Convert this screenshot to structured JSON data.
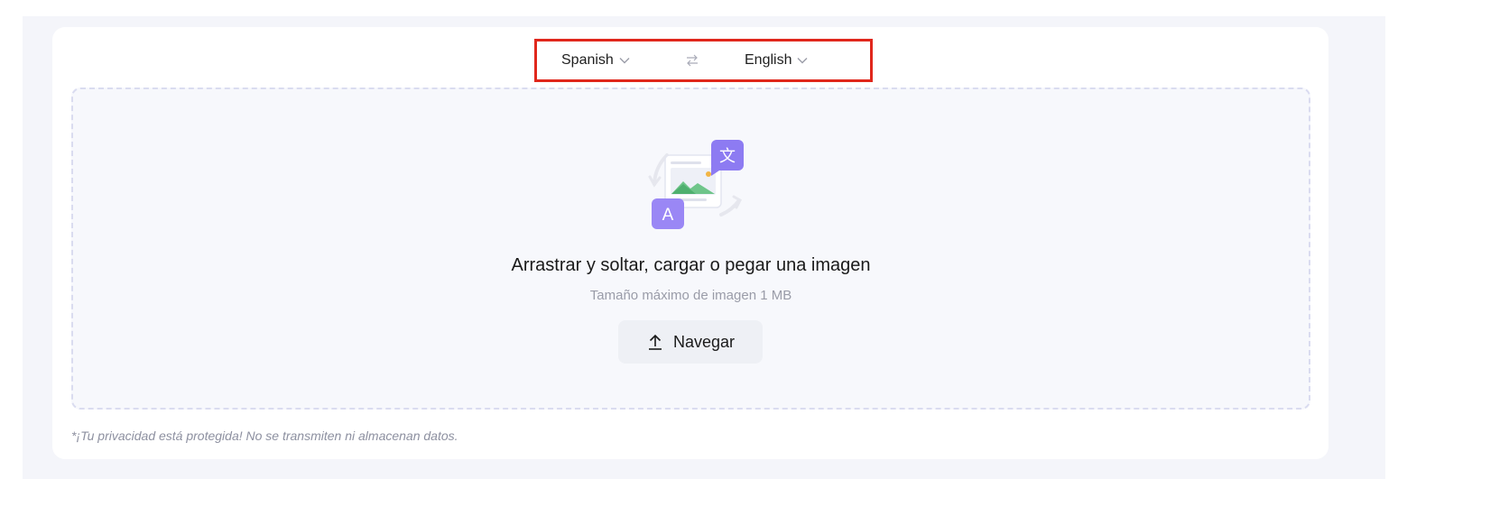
{
  "language_bar": {
    "source_language": "Spanish",
    "target_language": "English",
    "highlight_color": "#e0271c"
  },
  "icons": {
    "source_chevron": "chevron-down-icon",
    "target_chevron": "chevron-down-icon",
    "swap": "swap-arrows-icon",
    "illustration": "image-translate-illustration",
    "upload": "upload-icon"
  },
  "dropzone": {
    "title": "Arrastrar y soltar, cargar o pegar una imagen",
    "subtitle": "Tamaño máximo de imagen 1 MB",
    "browse_label": "Navegar",
    "illustration_badges": [
      "文",
      "A"
    ]
  },
  "footer": {
    "privacy_note": "*¡Tu privacidad está protegida! No se transmiten ni almacenan datos."
  },
  "colors": {
    "accent": "#8d7bf2",
    "panel_background": "#f4f5fa",
    "dashed_border": "#dadcf0"
  }
}
